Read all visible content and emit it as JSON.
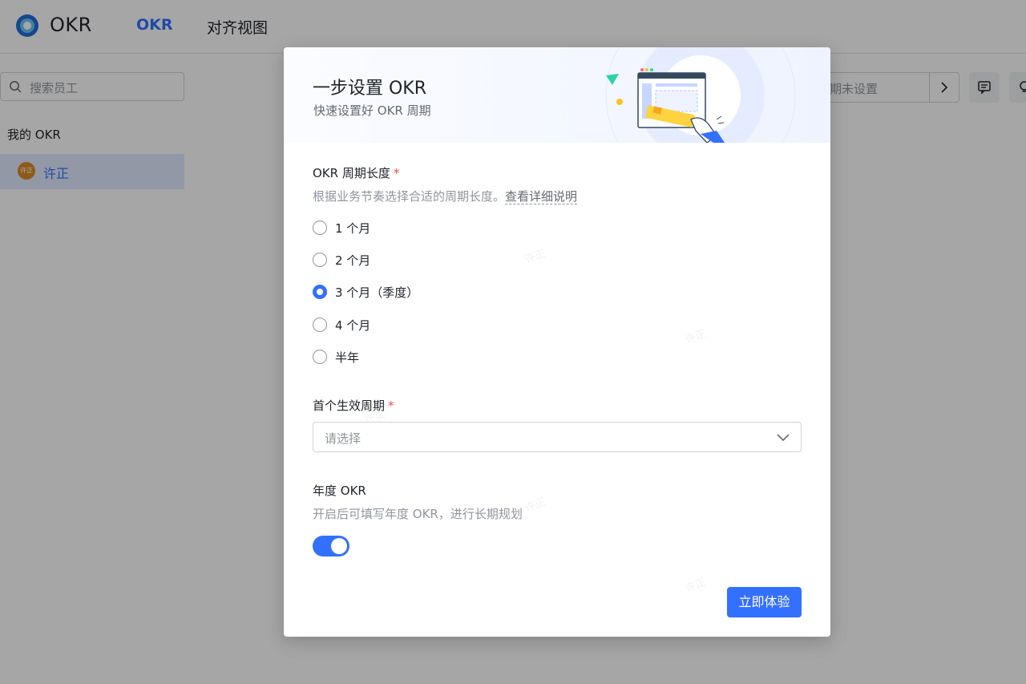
{
  "app": {
    "title": "OKR"
  },
  "nav": {
    "tabs": [
      {
        "label": "OKR",
        "active": true
      },
      {
        "label": "对齐视图",
        "active": false
      }
    ]
  },
  "sidebar": {
    "search_placeholder": "搜索员工",
    "section_title": "我的 OKR",
    "user": {
      "name": "许正",
      "avatar_text": "许正"
    }
  },
  "toolbar": {
    "period_placeholder": "期未设置"
  },
  "modal": {
    "title": "一步设置 OKR",
    "subtitle": "快速设置好 OKR 周期",
    "cycle_length": {
      "label": "OKR 周期长度",
      "required_mark": "*",
      "hint": "根据业务节奏选择合适的周期长度。",
      "hint_link": "查看详细说明",
      "options": [
        {
          "label": "1 个月",
          "checked": false
        },
        {
          "label": "2 个月",
          "checked": false
        },
        {
          "label": "3 个月（季度）",
          "checked": true
        },
        {
          "label": "4 个月",
          "checked": false
        },
        {
          "label": "半年",
          "checked": false
        }
      ]
    },
    "first_cycle": {
      "label": "首个生效周期",
      "required_mark": "*",
      "placeholder": "请选择"
    },
    "annual": {
      "label": "年度 OKR",
      "hint": "开启后可填写年度 OKR，进行长期规划",
      "enabled": true
    },
    "submit_label": "立即体验",
    "watermark": "许正"
  },
  "colors": {
    "accent": "#3370ff",
    "required": "#f54a45",
    "avatar": "#d98925"
  }
}
